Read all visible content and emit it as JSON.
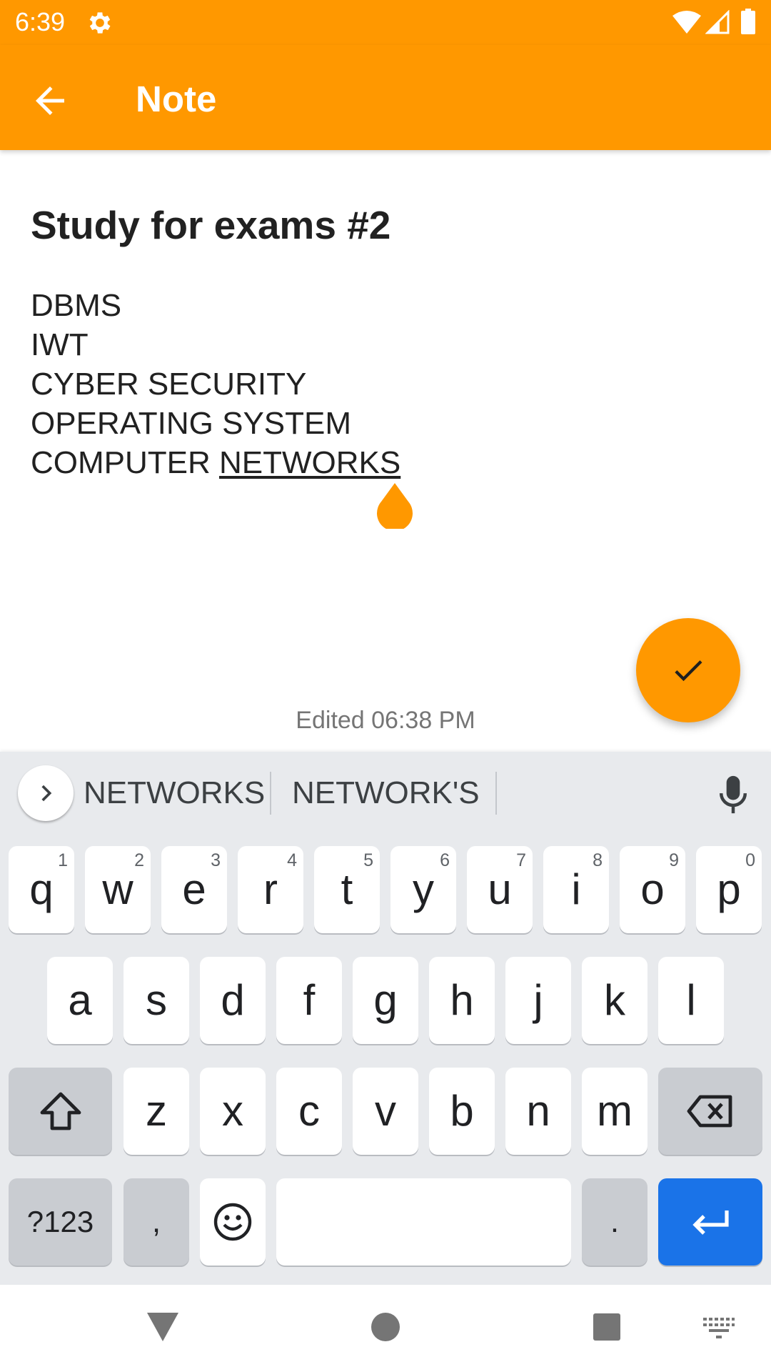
{
  "status_bar": {
    "time": "6:39",
    "icons": [
      "gear-icon",
      "wifi-icon",
      "signal-icon",
      "battery-icon"
    ]
  },
  "app_bar": {
    "title": "Note",
    "back_icon": "arrow-back-icon",
    "color": "#FF9800"
  },
  "note": {
    "title": "Study for exams #2",
    "lines": [
      "DBMS",
      "IWT",
      "CYBER SECURITY",
      "OPERATING SYSTEM"
    ],
    "last_line_prefix": "COMPUTER ",
    "last_line_composing": "NETWORKS",
    "edited_label": "Edited 06:38 PM"
  },
  "fab": {
    "icon": "check-icon"
  },
  "keyboard": {
    "suggestions": [
      "NETWORKS",
      "NETWORK'S"
    ],
    "row1": [
      {
        "key": "q",
        "hint": "1"
      },
      {
        "key": "w",
        "hint": "2"
      },
      {
        "key": "e",
        "hint": "3"
      },
      {
        "key": "r",
        "hint": "4"
      },
      {
        "key": "t",
        "hint": "5"
      },
      {
        "key": "y",
        "hint": "6"
      },
      {
        "key": "u",
        "hint": "7"
      },
      {
        "key": "i",
        "hint": "8"
      },
      {
        "key": "o",
        "hint": "9"
      },
      {
        "key": "p",
        "hint": "0"
      }
    ],
    "row2": [
      "a",
      "s",
      "d",
      "f",
      "g",
      "h",
      "j",
      "k",
      "l"
    ],
    "row3": [
      "z",
      "x",
      "c",
      "v",
      "b",
      "n",
      "m"
    ],
    "symbols_label": "?123",
    "comma_label": ",",
    "period_label": ".",
    "enter_color": "#1A73E8"
  },
  "nav_bar": {
    "icons": [
      "back-triangle-icon",
      "home-circle-icon",
      "recents-square-icon",
      "keyboard-switch-icon"
    ]
  }
}
